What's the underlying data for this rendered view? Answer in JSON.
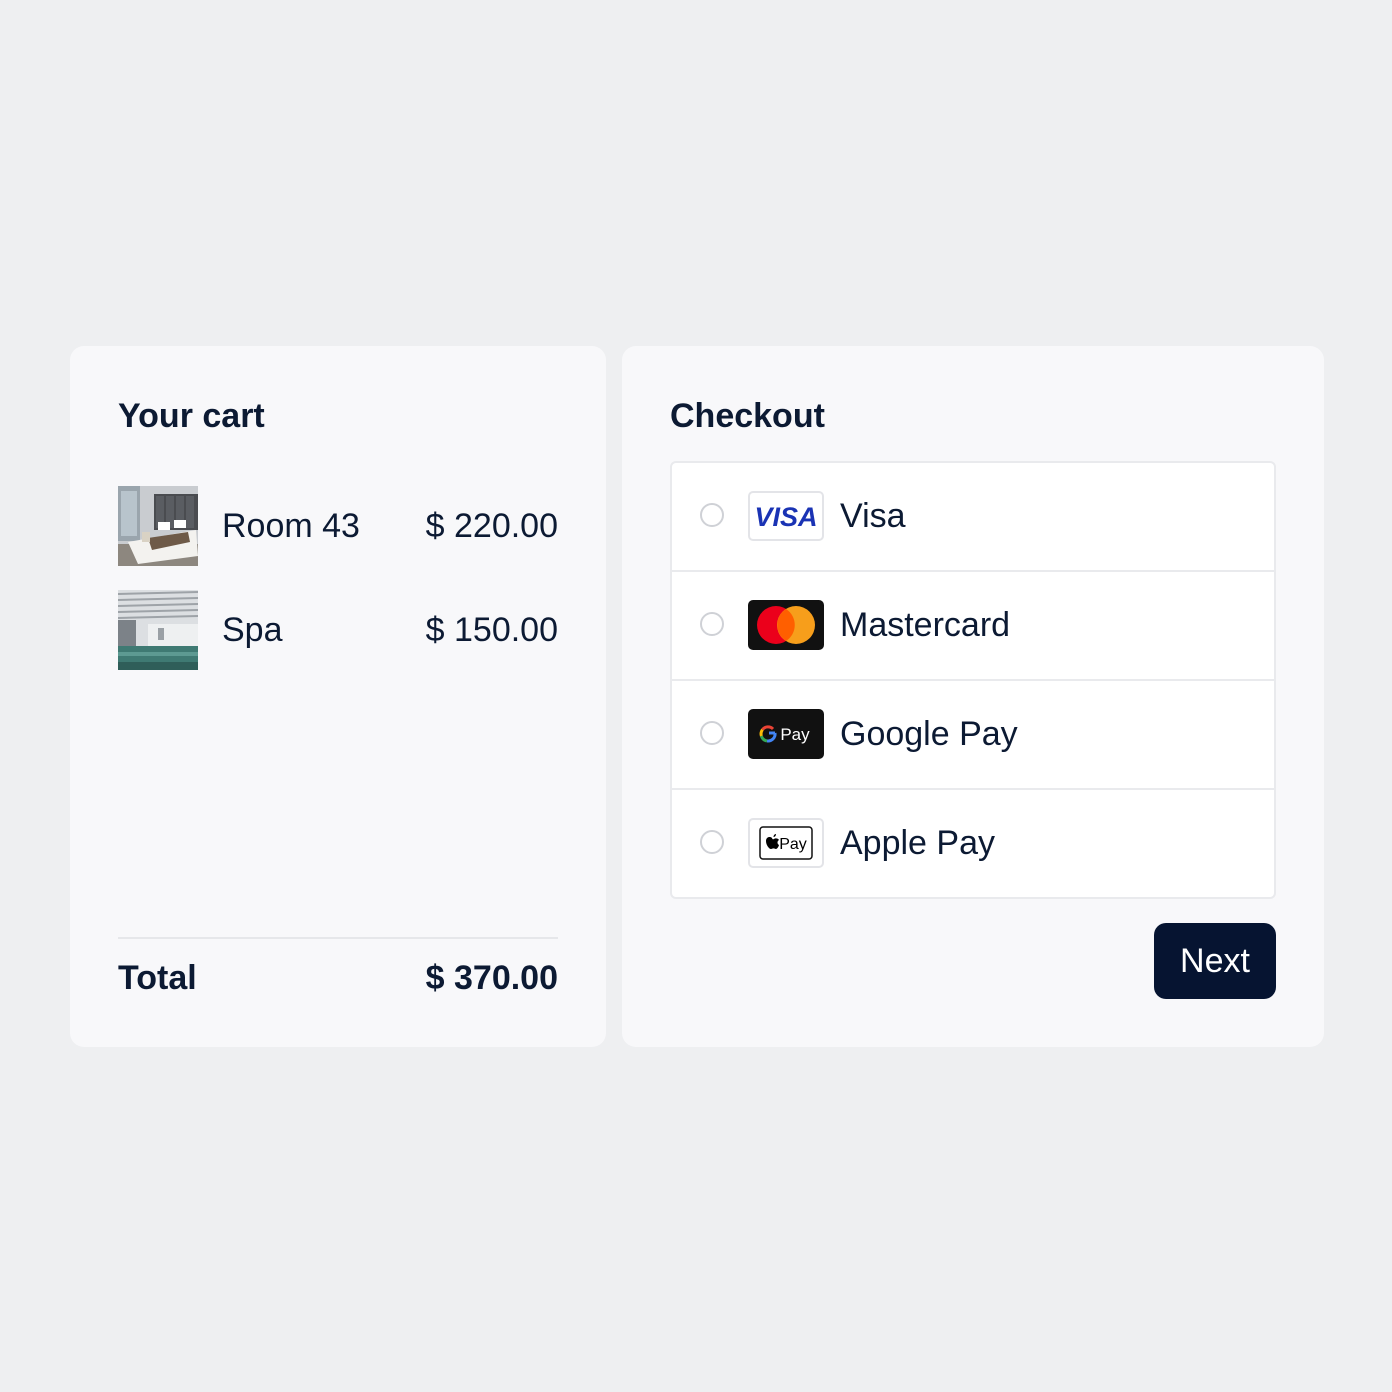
{
  "cart": {
    "title": "Your cart",
    "items": [
      {
        "name": "Room 43",
        "price": "$ 220.00",
        "image": "hotel-room-photo"
      },
      {
        "name": "Spa",
        "price": "$ 150.00",
        "image": "spa-pool-photo"
      }
    ],
    "total_label": "Total",
    "total_value": "$ 370.00"
  },
  "checkout": {
    "title": "Checkout",
    "methods": [
      {
        "label": "Visa",
        "logo": "visa-logo",
        "selected": false
      },
      {
        "label": "Mastercard",
        "logo": "mastercard-logo",
        "selected": false
      },
      {
        "label": "Google Pay",
        "logo": "google-pay-logo",
        "selected": false
      },
      {
        "label": "Apple Pay",
        "logo": "apple-pay-logo",
        "selected": false
      }
    ],
    "logo_text": {
      "visa": "VISA",
      "gpay": "Pay",
      "apay": "Pay"
    },
    "next_label": "Next"
  },
  "colors": {
    "page_bg": "#eeeff1",
    "panel_bg": "#f8f8fa",
    "text": "#0c1a33",
    "button_bg": "#061431",
    "visa_blue": "#1a33b4",
    "mastercard_red": "#eb001b",
    "mastercard_orange": "#f79e1b"
  }
}
